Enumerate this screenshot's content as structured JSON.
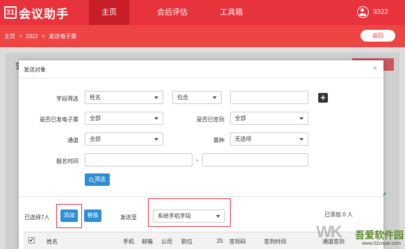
{
  "app": {
    "logo_mark": "31",
    "logo_text": "会议助手"
  },
  "nav": {
    "tabs": [
      {
        "label": "主页",
        "active": true
      },
      {
        "label": "会后评估",
        "active": false
      },
      {
        "label": "工具箱",
        "active": false
      }
    ],
    "user_name": "3322"
  },
  "breadcrumb": {
    "items": [
      "主页",
      ">",
      "3322",
      ">",
      "发送电子票"
    ],
    "back_label": "返回"
  },
  "modal": {
    "title": "发送对象",
    "close_glyph": "×",
    "filter": {
      "field_label": "字段筛选",
      "field_value": "姓名",
      "op_value": "包含",
      "keyword_value": "",
      "plus_glyph": "+",
      "sent_ticket_label": "是否已发电子票",
      "sent_ticket_value": "全部",
      "checked_in_label": "是否已签到",
      "checked_in_value": "全部",
      "channel_label": "通道",
      "channel_value": "全部",
      "ticket_type_label": "票种",
      "ticket_type_value": "无选项",
      "signup_time_label": "报名时间",
      "range_sep": "~",
      "filter_button": "筛选"
    },
    "actions": {
      "selected_text": "已选择7人",
      "add_button": "添加",
      "replace_button": "替换",
      "send_to_label": "发送至",
      "send_to_value": "系统手机字段",
      "added_text": "已添加 0 人"
    },
    "table": {
      "select_all_glyph": "✔",
      "headers": [
        "姓名",
        "手机",
        "邮箱",
        "公司",
        "职位",
        "25",
        "签到码",
        "签到时间",
        "通道签到"
      ]
    }
  },
  "background": {
    "logo": "会议"
  },
  "watermark": {
    "title": "吾爱软件园",
    "url": "www.52zixue.com",
    "logo": "WK"
  },
  "colors": {
    "brand_red": "#e8323c",
    "button_blue": "#2b8ed6"
  }
}
